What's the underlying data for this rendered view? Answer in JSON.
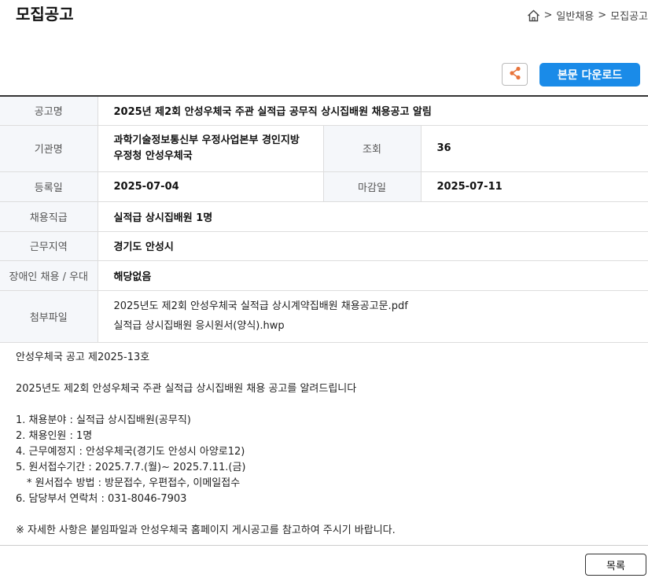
{
  "header": {
    "page_title": "모집공고",
    "breadcrumb": {
      "sep1": ">",
      "item1": "일반채용",
      "sep2": ">",
      "item2": "모집공고"
    }
  },
  "toolbar": {
    "share_icon": "share-icon",
    "download_label": "본문 다운로드"
  },
  "info": {
    "title_label": "공고명",
    "title_value": "2025년 제2회 안성우체국 주관 실적급 공무직 상시집배원 채용공고 알림",
    "org_label": "기관명",
    "org_value_line1": "과학기술정보통신부 우정사업본부 경인지방",
    "org_value_line2": "우정청 안성우체국",
    "views_label": "조회",
    "views_value": "36",
    "reg_label": "등록일",
    "reg_value": "2025-07-04",
    "deadline_label": "마감일",
    "deadline_value": "2025-07-11",
    "job_label": "채용직급",
    "job_value": "실적급 상시집배원 1명",
    "area_label": "근무지역",
    "area_value": "경기도 안성시",
    "disabled_label": "장애인 채용 / 우대",
    "disabled_value": "해당없음",
    "files_label": "첨부파일",
    "files": [
      "2025년도 제2회 안성우체국 실적급 상시계약집배원 채용공고문.pdf",
      "실적급 상시집배원 응시원서(양식).hwp"
    ]
  },
  "body": {
    "line1": "안성우체국 공고 제2025-13호",
    "line2": "2025년도 제2회 안성우체국 주관 실적급 상시집배원 채용 공고를 알려드립니다",
    "item1": "1. 채용분야 : 실적급 상시집배원(공무직)",
    "item2": "2. 채용인원 : 1명",
    "item3": "4. 근무예정지 : 안성우체국(경기도 안성시 아양로12)",
    "item4": "5. 원서접수기간 : 2025.7.7.(월)~ 2025.7.11.(금)",
    "item5": "* 원서접수 방법 : 방문접수, 우편접수, 이메일접수",
    "item6": "6.  담당부서 연락처 : 031-8046-7903",
    "note": "※ 자세한 사항은 붙임파일과 안성우체국 홈페이지 게시공고를 참고하여 주시기 바랍니다."
  },
  "footer": {
    "list_label": "목록"
  },
  "colors": {
    "accent": "#1a8be8",
    "share_icon": "#e8743b",
    "header_cell_bg": "#f5f7fa"
  }
}
